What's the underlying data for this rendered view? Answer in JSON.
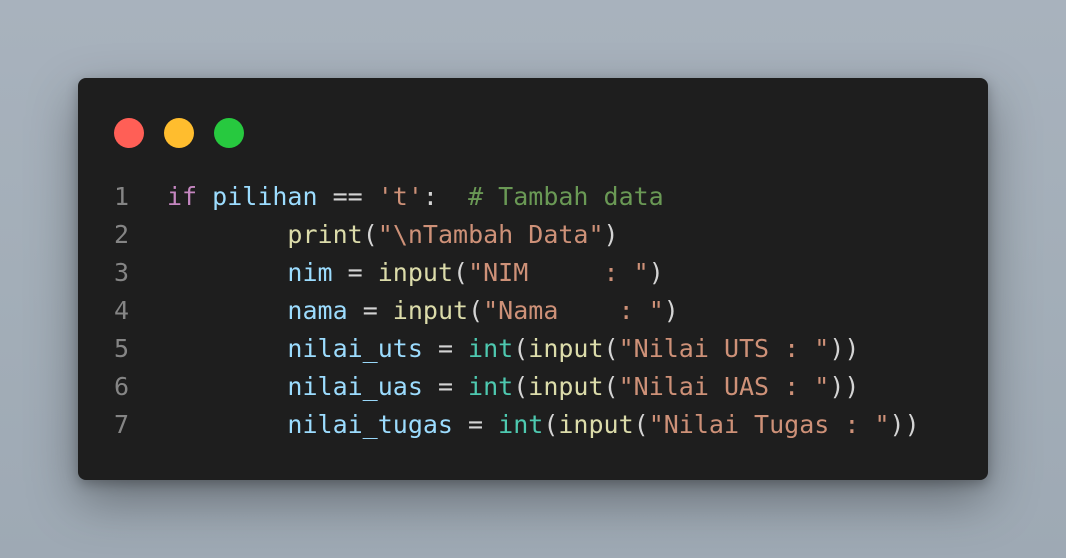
{
  "window": {
    "buttons": [
      "close",
      "minimize",
      "maximize"
    ],
    "colors": {
      "close": "#ff5f56",
      "minimize": "#ffbd2e",
      "maximize": "#27c93f",
      "background": "#1e1e1e"
    }
  },
  "code": {
    "language": "python",
    "lines": [
      {
        "number": "1",
        "tokens": [
          {
            "t": "if",
            "c": "kw"
          },
          {
            "t": " ",
            "c": "op"
          },
          {
            "t": "pilihan",
            "c": "var"
          },
          {
            "t": " == ",
            "c": "op"
          },
          {
            "t": "'t'",
            "c": "str"
          },
          {
            "t": ":  ",
            "c": "op"
          },
          {
            "t": "# Tambah data",
            "c": "cmt"
          }
        ]
      },
      {
        "number": "2",
        "tokens": [
          {
            "t": "        ",
            "c": "op"
          },
          {
            "t": "print",
            "c": "fn"
          },
          {
            "t": "(",
            "c": "punc"
          },
          {
            "t": "\"",
            "c": "str"
          },
          {
            "t": "\\n",
            "c": "str"
          },
          {
            "t": "Tambah Data\"",
            "c": "str"
          },
          {
            "t": ")",
            "c": "punc"
          }
        ]
      },
      {
        "number": "3",
        "tokens": [
          {
            "t": "        ",
            "c": "op"
          },
          {
            "t": "nim",
            "c": "var"
          },
          {
            "t": " = ",
            "c": "op"
          },
          {
            "t": "input",
            "c": "fn"
          },
          {
            "t": "(",
            "c": "punc"
          },
          {
            "t": "\"NIM     : \"",
            "c": "str"
          },
          {
            "t": ")",
            "c": "punc"
          }
        ]
      },
      {
        "number": "4",
        "tokens": [
          {
            "t": "        ",
            "c": "op"
          },
          {
            "t": "nama",
            "c": "var"
          },
          {
            "t": " = ",
            "c": "op"
          },
          {
            "t": "input",
            "c": "fn"
          },
          {
            "t": "(",
            "c": "punc"
          },
          {
            "t": "\"Nama    : \"",
            "c": "str"
          },
          {
            "t": ")",
            "c": "punc"
          }
        ]
      },
      {
        "number": "5",
        "tokens": [
          {
            "t": "        ",
            "c": "op"
          },
          {
            "t": "nilai_uts",
            "c": "var"
          },
          {
            "t": " = ",
            "c": "op"
          },
          {
            "t": "int",
            "c": "type"
          },
          {
            "t": "(",
            "c": "punc"
          },
          {
            "t": "input",
            "c": "fn"
          },
          {
            "t": "(",
            "c": "punc"
          },
          {
            "t": "\"Nilai UTS : \"",
            "c": "str"
          },
          {
            "t": "))",
            "c": "punc"
          }
        ]
      },
      {
        "number": "6",
        "tokens": [
          {
            "t": "        ",
            "c": "op"
          },
          {
            "t": "nilai_uas",
            "c": "var"
          },
          {
            "t": " = ",
            "c": "op"
          },
          {
            "t": "int",
            "c": "type"
          },
          {
            "t": "(",
            "c": "punc"
          },
          {
            "t": "input",
            "c": "fn"
          },
          {
            "t": "(",
            "c": "punc"
          },
          {
            "t": "\"Nilai UAS : \"",
            "c": "str"
          },
          {
            "t": "))",
            "c": "punc"
          }
        ]
      },
      {
        "number": "7",
        "tokens": [
          {
            "t": "        ",
            "c": "op"
          },
          {
            "t": "nilai_tugas",
            "c": "var"
          },
          {
            "t": " = ",
            "c": "op"
          },
          {
            "t": "int",
            "c": "type"
          },
          {
            "t": "(",
            "c": "punc"
          },
          {
            "t": "input",
            "c": "fn"
          },
          {
            "t": "(",
            "c": "punc"
          },
          {
            "t": "\"Nilai Tugas : \"",
            "c": "str"
          },
          {
            "t": "))",
            "c": "punc"
          }
        ]
      }
    ]
  }
}
